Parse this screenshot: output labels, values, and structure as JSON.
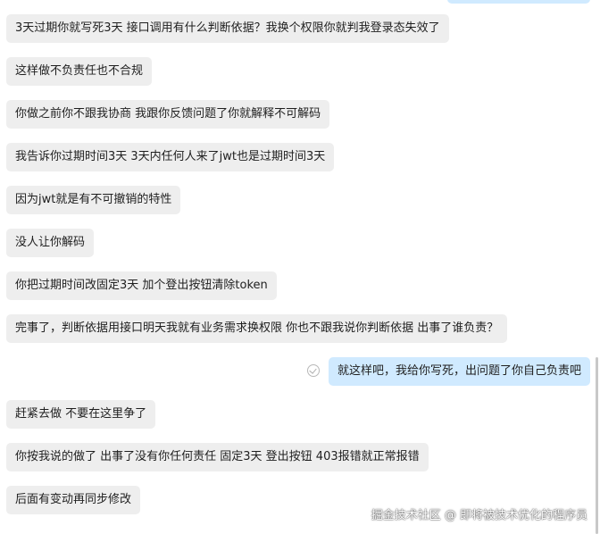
{
  "messages": [
    {
      "side": "in",
      "text": "3天过期你就写死3天 接口调用有什么判断依据？我换个权限你就判我登录态失效了"
    },
    {
      "side": "in",
      "text": "这样做不负责任也不合规"
    },
    {
      "side": "in",
      "text": "你做之前你不跟我协商 我跟你反馈问题了你就解释不可解码"
    },
    {
      "side": "in",
      "text": "我告诉你过期时间3天 3天内任何人来了jwt也是过期时间3天"
    },
    {
      "side": "in",
      "text": "因为jwt就是有不可撤销的特性"
    },
    {
      "side": "in",
      "text": "没人让你解码"
    },
    {
      "side": "in",
      "text": "你把过期时间改固定3天 加个登出按钮清除token"
    },
    {
      "side": "in",
      "text": "完事了，判断依据用接口明天我就有业务需求换权限 你也不跟我说你判断依据 出事了谁负责？"
    },
    {
      "side": "out",
      "text": "就这样吧，我给你写死，出问题了你自己负责吧"
    },
    {
      "side": "in",
      "text": "赶紧去做 不要在这里争了"
    },
    {
      "side": "in",
      "text": "你按我说的做了 出事了没有你任何责任  固定3天 登出按钮 403报错就正常报错"
    },
    {
      "side": "in",
      "text": "后面有变动再同步修改"
    }
  ],
  "watermark": "掘金技术社区 @ 即将被技术优化的程序员"
}
